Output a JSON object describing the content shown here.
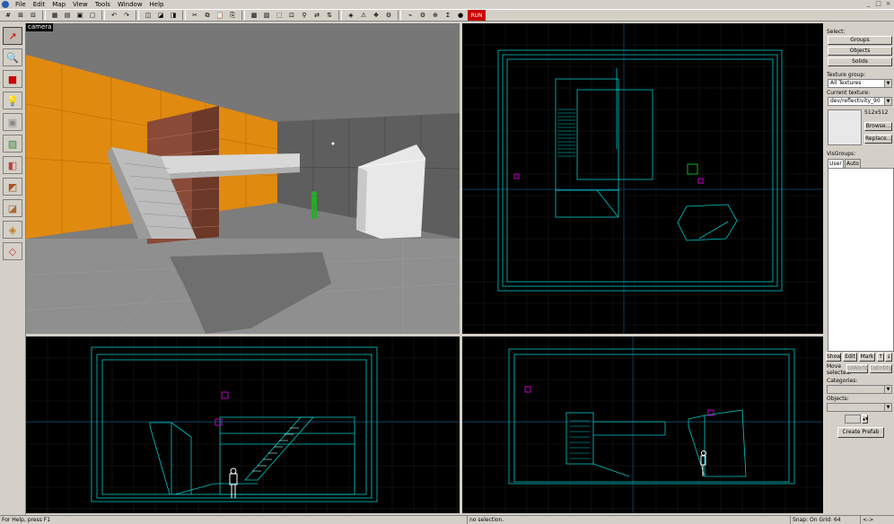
{
  "menu": [
    "File",
    "Edit",
    "Map",
    "View",
    "Tools",
    "Window",
    "Help"
  ],
  "window_controls": [
    "_",
    "□",
    "×"
  ],
  "toolbar": {
    "run_label": "RUN"
  },
  "camera": {
    "label": "camera"
  },
  "right_panel": {
    "select_label": "Select:",
    "groups_button": "Groups",
    "objects_button": "Objects",
    "solids_button": "Solids",
    "texture_group_label": "Texture group:",
    "texture_group_value": "All Textures",
    "current_texture_label": "Current texture:",
    "current_texture_value": "dev/reflectivity_90",
    "texture_size": "512x512",
    "browse_button": "Browse...",
    "replace_button": "Replace...",
    "visgroups_label": "VisGroups:",
    "tab_user": "User",
    "tab_auto": "Auto",
    "show_button": "Show",
    "edit_button": "Edit",
    "mark_button": "Mark",
    "up_button": "↑",
    "down_button": "↓",
    "move_selected_label": "Move selected:",
    "to_world_button": "toWorld",
    "to_entity_button": "toEntity",
    "categories_label": "Categories:",
    "objects_label": "Objects:",
    "create_prefab_button": "Create Prefab"
  },
  "status": {
    "help": "For Help, press F1",
    "selection": "no selection.",
    "snap": "Snap: On Grid: 64",
    "extra": "<->"
  },
  "colors": {
    "wire": "#00c8c8",
    "grid": "#1c1c1c",
    "axis": "#0a3a5a",
    "entity": "#c000c0",
    "orange_wall": "#e08a10"
  }
}
